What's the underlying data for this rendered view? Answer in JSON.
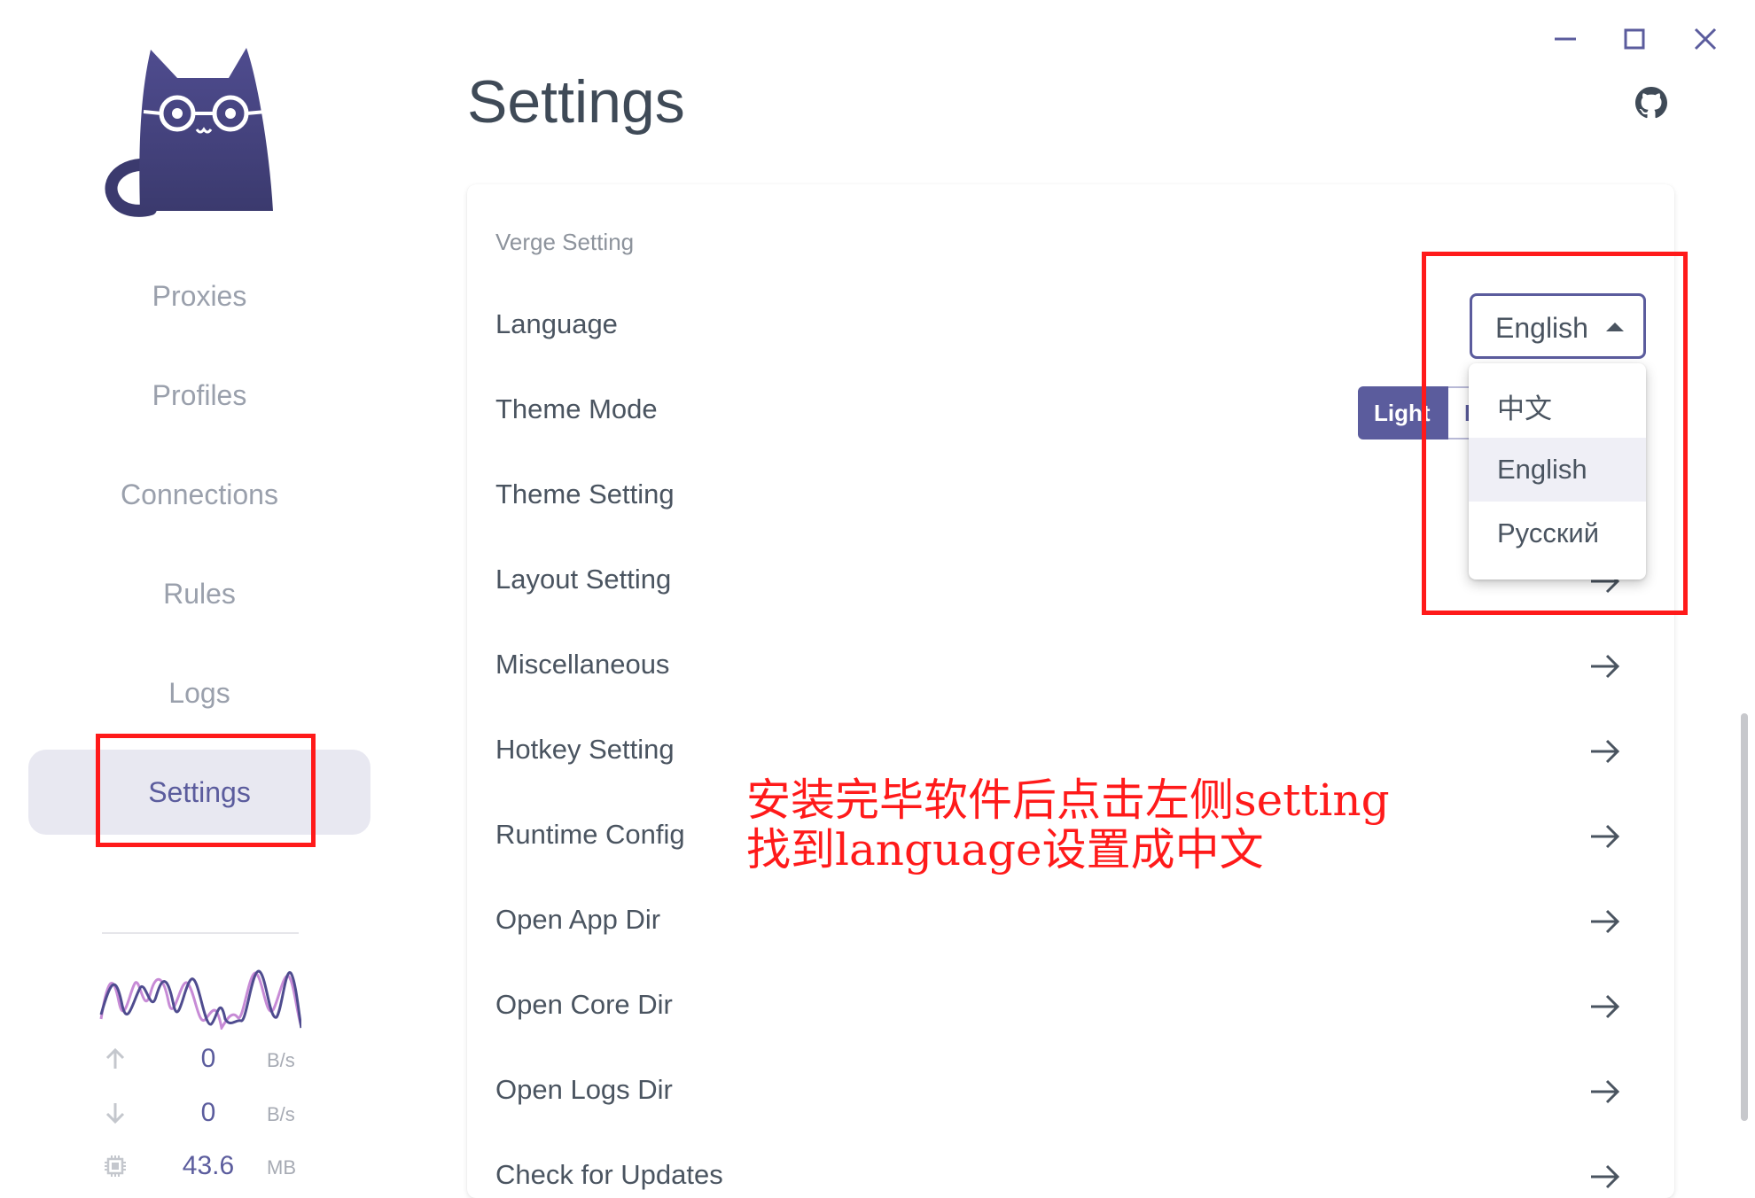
{
  "window": {
    "minimize_icon": "minimize-icon",
    "maximize_icon": "maximize-icon",
    "close_icon": "close-icon"
  },
  "sidebar": {
    "logo": "cat-logo",
    "items": [
      {
        "label": "Proxies"
      },
      {
        "label": "Profiles"
      },
      {
        "label": "Connections"
      },
      {
        "label": "Rules"
      },
      {
        "label": "Logs"
      },
      {
        "label": "Settings",
        "active": true
      }
    ],
    "traffic": {
      "upload": {
        "value": "0",
        "unit": "B/s"
      },
      "download": {
        "value": "0",
        "unit": "B/s"
      },
      "memory": {
        "value": "43.6",
        "unit": "MB"
      }
    }
  },
  "header": {
    "title": "Settings",
    "github_icon": "github-icon"
  },
  "settings": {
    "section_title": "Verge Setting",
    "language": {
      "label": "Language",
      "selected": "English",
      "options": [
        "中文",
        "English",
        "Русский"
      ]
    },
    "theme_mode": {
      "label": "Theme Mode",
      "options": [
        "Light",
        "Dark"
      ],
      "active": "Light"
    },
    "rows": [
      {
        "label": "Theme Setting"
      },
      {
        "label": "Layout Setting"
      },
      {
        "label": "Miscellaneous"
      },
      {
        "label": "Hotkey Setting"
      },
      {
        "label": "Runtime Config"
      },
      {
        "label": "Open App Dir"
      },
      {
        "label": "Open Core Dir"
      },
      {
        "label": "Open Logs Dir"
      },
      {
        "label": "Check for Updates"
      }
    ]
  },
  "annotation": {
    "line1": "安装完毕软件后点击左侧setting",
    "line2": "找到language设置成中文"
  },
  "colors": {
    "accent": "#5b5c9d",
    "annotation": "#ff1a1a",
    "nav_text": "#9aa0ac",
    "nav_active_bg": "#e8e8f1"
  }
}
